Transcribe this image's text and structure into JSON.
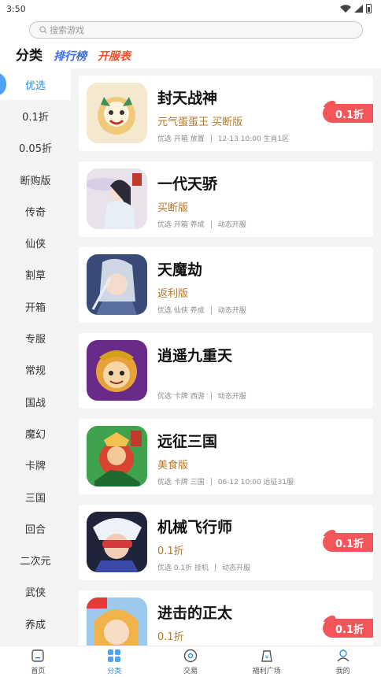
{
  "status": {
    "time": "3:50"
  },
  "search": {
    "placeholder": "搜索游戏"
  },
  "tabs": {
    "main": "分类",
    "rank": "排行榜",
    "server": "开服表"
  },
  "sidebar": {
    "items": [
      "优选",
      "0.1折",
      "0.05折",
      "断购版",
      "传奇",
      "仙侠",
      "割草",
      "开箱",
      "专服",
      "常规",
      "国战",
      "魔幻",
      "卡牌",
      "三国",
      "回合",
      "二次元",
      "武侠",
      "养成"
    ],
    "active_index": 0
  },
  "games": [
    {
      "title": "封天战神",
      "subtitle": "元气蛋蛋王 买断版",
      "tags": "优选 开箱 放置",
      "info": "12-13 10:00 生肖1区",
      "badge": "0.1折"
    },
    {
      "title": "一代天骄",
      "subtitle": "买断版",
      "tags": "优选 开箱 养成",
      "info": "动态开服",
      "badge": ""
    },
    {
      "title": "天魔劫",
      "subtitle": "返利版",
      "tags": "优选 仙侠 养成",
      "info": "动态开服",
      "badge": ""
    },
    {
      "title": "逍遥九重天",
      "subtitle": "",
      "tags": "优选 卡牌 西游",
      "info": "动态开服",
      "badge": ""
    },
    {
      "title": "远征三国",
      "subtitle": "美食版",
      "tags": "优选 卡牌 三国",
      "info": "06-12 10:00 远征31服",
      "badge": ""
    },
    {
      "title": "机械飞行师",
      "subtitle": "0.1折",
      "tags": "优选 0.1折 挂机",
      "info": "动态开服",
      "badge": "0.1折"
    },
    {
      "title": "进击的正太",
      "subtitle": "0.1折",
      "tags": "",
      "info": "",
      "badge": "0.1折"
    }
  ],
  "bottom_nav": {
    "home": "首页",
    "category": "分类",
    "trade": "交易",
    "welfare": "福利广场",
    "mine": "我的"
  },
  "colors": {
    "accent": "#2d8cf0",
    "badge": "#f2565a",
    "subtitle": "#b5782c"
  }
}
